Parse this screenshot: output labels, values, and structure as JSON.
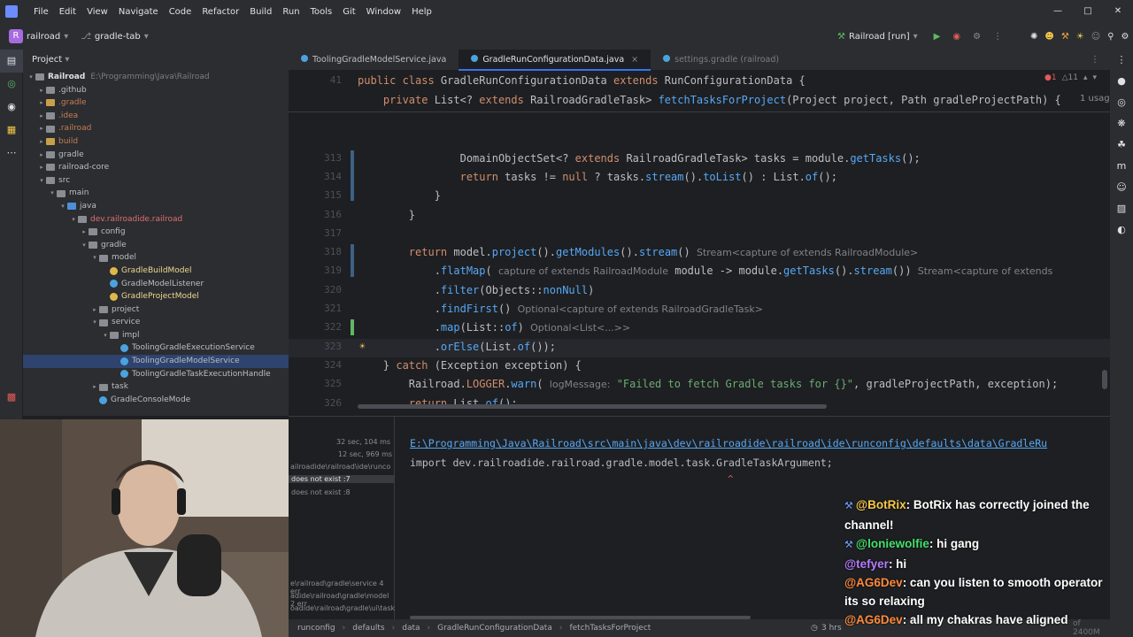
{
  "menu": [
    "File",
    "Edit",
    "View",
    "Navigate",
    "Code",
    "Refactor",
    "Build",
    "Run",
    "Tools",
    "Git",
    "Window",
    "Help"
  ],
  "toolbar": {
    "project_initial": "R",
    "project": "railroad",
    "branch": "gradle-tab",
    "run_config": "Railroad [run]"
  },
  "project_panel": {
    "title": "Project",
    "rows": [
      {
        "label": "Railroad",
        "path": "E:\\Programming\\Java\\Railroad",
        "depth": 0,
        "icon": "folder",
        "open": true
      },
      {
        "label": ".github",
        "depth": 1,
        "icon": "folder",
        "open": false
      },
      {
        "label": ".gradle",
        "depth": 1,
        "icon": "folder-orange",
        "open": false
      },
      {
        "label": ".idea",
        "depth": 1,
        "icon": "folder",
        "open": false
      },
      {
        "label": ".railroad",
        "depth": 1,
        "icon": "folder",
        "open": false
      },
      {
        "label": "build",
        "depth": 1,
        "icon": "folder-orange",
        "open": false
      },
      {
        "label": "gradle",
        "depth": 1,
        "icon": "folder",
        "open": false
      },
      {
        "label": "railroad-core",
        "depth": 1,
        "icon": "folder",
        "open": false
      },
      {
        "label": "src",
        "depth": 1,
        "icon": "folder",
        "open": true
      },
      {
        "label": "main",
        "depth": 2,
        "icon": "folder",
        "open": true
      },
      {
        "label": "java",
        "depth": 3,
        "icon": "folder-src",
        "open": true
      },
      {
        "label": "dev.railroadide.railroad",
        "depth": 4,
        "icon": "folder",
        "open": true
      },
      {
        "label": "config",
        "depth": 5,
        "icon": "folder",
        "open": false
      },
      {
        "label": "gradle",
        "depth": 5,
        "icon": "folder",
        "open": true
      },
      {
        "label": "model",
        "depth": 6,
        "icon": "folder",
        "open": true
      },
      {
        "label": "GradleBuildModel",
        "depth": 7,
        "icon": "class-yellow",
        "open": null
      },
      {
        "label": "GradleModelListener",
        "depth": 7,
        "icon": "class",
        "open": null
      },
      {
        "label": "GradleProjectModel",
        "depth": 7,
        "icon": "class-yellow",
        "open": null
      },
      {
        "label": "project",
        "depth": 6,
        "icon": "folder",
        "open": false
      },
      {
        "label": "service",
        "depth": 6,
        "icon": "folder",
        "open": true
      },
      {
        "label": "impl",
        "depth": 7,
        "icon": "folder",
        "open": true
      },
      {
        "label": "ToolingGradleExecutionService",
        "depth": 8,
        "icon": "class",
        "open": null
      },
      {
        "label": "ToolingGradleModelService",
        "depth": 8,
        "icon": "class",
        "open": null,
        "selected": true
      },
      {
        "label": "ToolingGradleTaskExecutionHandle",
        "depth": 8,
        "icon": "class",
        "open": null
      },
      {
        "label": "task",
        "depth": 6,
        "icon": "folder",
        "open": false
      },
      {
        "label": "GradleConsoleMode",
        "depth": 6,
        "icon": "class",
        "open": null
      }
    ]
  },
  "tabs": [
    {
      "label": "ToolingGradleModelService.java",
      "state": "normal"
    },
    {
      "label": "GradleRunConfigurationData.java",
      "state": "active"
    },
    {
      "label": "settings.gradle (railroad)",
      "state": "dim"
    }
  ],
  "editor": {
    "warnings": "1",
    "infos": "11",
    "usage_hint": "1 usag"
  },
  "code_lines": [
    {
      "n": "41",
      "html": "<span class='kw'>public class</span> GradleRunConfigurationData <span class='kw'>extends</span> RunConfigurationData {"
    },
    {
      "n": "",
      "html": "    <span class='kw'>private</span> List&lt;? <span class='kw'>extends</span> RailroadGradleTask&gt; <span class='fn'>fetchTasksForProject</span>(Project project, Path gradleProjectPath) {"
    },
    {
      "n": "313",
      "html": "                DomainObjectSet&lt;? <span class='kw'>extends</span> RailroadGradleTask&gt; tasks = module.<span class='fn'>getTasks</span>();"
    },
    {
      "n": "314",
      "html": "                <span class='kw'>return</span> tasks != <span class='kw'>null</span> ? tasks.<span class='fn'>stream</span>().<span class='fn'>toList</span>() : List.<span class='fn'>of</span>();"
    },
    {
      "n": "315",
      "html": "            }"
    },
    {
      "n": "316",
      "html": "        }"
    },
    {
      "n": "317",
      "html": ""
    },
    {
      "n": "318",
      "html": "        <span class='kw'>return</span> model.<span class='fn'>project</span>().<span class='fn'>getModules</span>().<span class='fn'>stream</span>() <span class='hint'>Stream&lt;capture of extends RailroadModule&gt;</span>"
    },
    {
      "n": "319",
      "html": "            .<span class='fn'>flatMap</span>( <span class='hint'>capture of extends RailroadModule</span> module -&gt; module.<span class='fn'>getTasks</span>().<span class='fn'>stream</span>()) <span class='hint'>Stream&lt;capture of extends</span>"
    },
    {
      "n": "320",
      "html": "            .<span class='fn'>filter</span>(Objects::<span class='fn'>nonNull</span>)"
    },
    {
      "n": "321",
      "html": "            .<span class='fn'>findFirst</span>() <span class='hint'>Optional&lt;capture of extends RailroadGradleTask&gt;</span>"
    },
    {
      "n": "322",
      "html": "            .<span class='fn'>map</span>(List::<span class='fn'>of</span>) <span class='hint'>Optional&lt;List&lt;...&gt;&gt;</span>"
    },
    {
      "n": "323",
      "html": "            .<span class='fn'>orElse</span>(List.<span class='fn'>of</span>());"
    },
    {
      "n": "324",
      "html": "    } <span class='kw'>catch</span> (Exception exception) {"
    },
    {
      "n": "325",
      "html": "        Railroad.<span class='kw'>LOGGER</span>.<span class='fn'>warn</span>( <span class='hint'>logMessage:</span> <span class='st'>\"Failed to fetch Gradle tasks for {}\"</span>, gradleProjectPath, exception);"
    },
    {
      "n": "326",
      "html": "        <span class='kw'>return</span> List.<span class='fn'>of</span>();"
    },
    {
      "n": "327",
      "html": "    }"
    },
    {
      "n": "328",
      "html": "}"
    }
  ],
  "build_panel": {
    "times": [
      "32 sec, 104 ms",
      "12 sec, 969 ms"
    ],
    "items": [
      "ailroadide\\railroad\\ide\\runco",
      "does not exist :7",
      "does not exist :8"
    ],
    "bottom_items": [
      "e\\railroad\\gradle\\service 4 err",
      "adide\\railroad\\gradle\\model 2 err",
      "oadide\\railroad\\gradle\\ui\\task"
    ],
    "path": "E:\\Programming\\Java\\Railroad\\src\\main\\java\\dev\\railroadide\\railroad\\ide\\runconfig\\defaults\\data\\GradleRu",
    "import_line": "import dev.railroadide.railroad.gradle.model.task.GradleTaskArgument;",
    "caret": "^"
  },
  "breadcrumb": [
    "runconfig",
    "defaults",
    "data",
    "GradleRunConfigurationData",
    "fetchTasksForProject"
  ],
  "status_right": "3 hrs",
  "status_mem": "of 2400M",
  "chat": [
    {
      "user": "@BotRix",
      "color": "#f7c948",
      "text": ": BotRix has correctly joined the channel!"
    },
    {
      "user": "@loniewolfie",
      "color": "#45e06b",
      "text": ": hi gang"
    },
    {
      "user": "@tefyer",
      "color": "#b77cff",
      "text": ": hi"
    },
    {
      "user": "@AG6Dev",
      "color": "#ff8a3c",
      "text": ": can you listen to smooth operator its so relaxing"
    },
    {
      "user": "@AG6Dev",
      "color": "#ff8a3c",
      "text": ": all my chakras have aligned"
    }
  ]
}
